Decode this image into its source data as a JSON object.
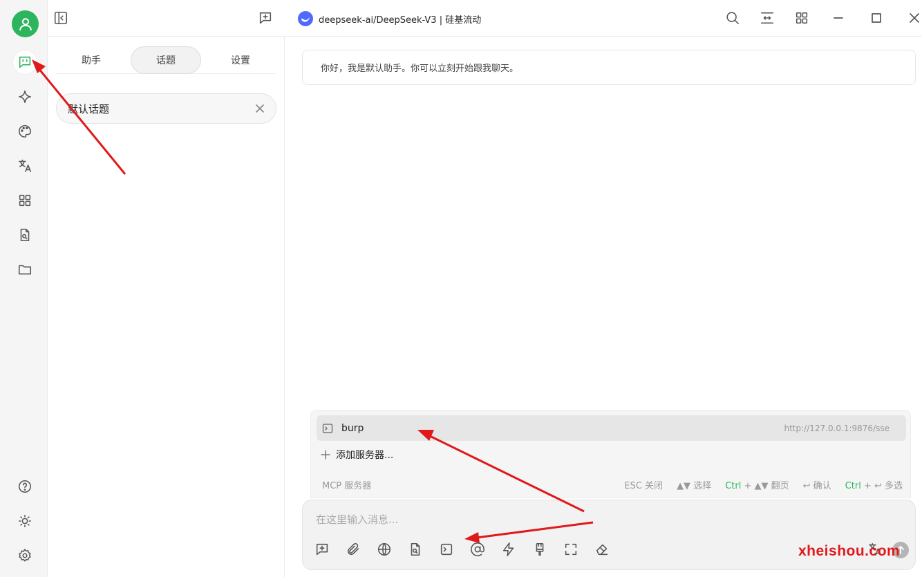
{
  "topbar": {
    "model_title": "deepseek-ai/DeepSeek-V3 | 硅基流动"
  },
  "sidepanel": {
    "tabs": [
      "助手",
      "话题",
      "设置"
    ],
    "active_tab": "话题",
    "topic_label": "默认话题"
  },
  "chat": {
    "welcome": "你好，我是默认助手。你可以立刻开始跟我聊天。"
  },
  "mcp": {
    "server_name": "burp",
    "server_url": "http://127.0.0.1:9876/sse",
    "add_server": "添加服务器...",
    "footer_title": "MCP 服务器",
    "esc": "ESC 关闭",
    "select": "▲▼ 选择",
    "page_ctrl": "Ctrl",
    "page_rest": " + ▲▼ 翻页",
    "confirm": "↩ 确认",
    "multi_ctrl": "Ctrl",
    "multi_rest": " + ↩ 多选"
  },
  "input": {
    "placeholder": "在这里输入消息..."
  },
  "watermark": "xheishou.com",
  "colors": {
    "accent": "#2db55d",
    "annotation": "#e0191b",
    "deepseek": "#4d6bfe"
  }
}
